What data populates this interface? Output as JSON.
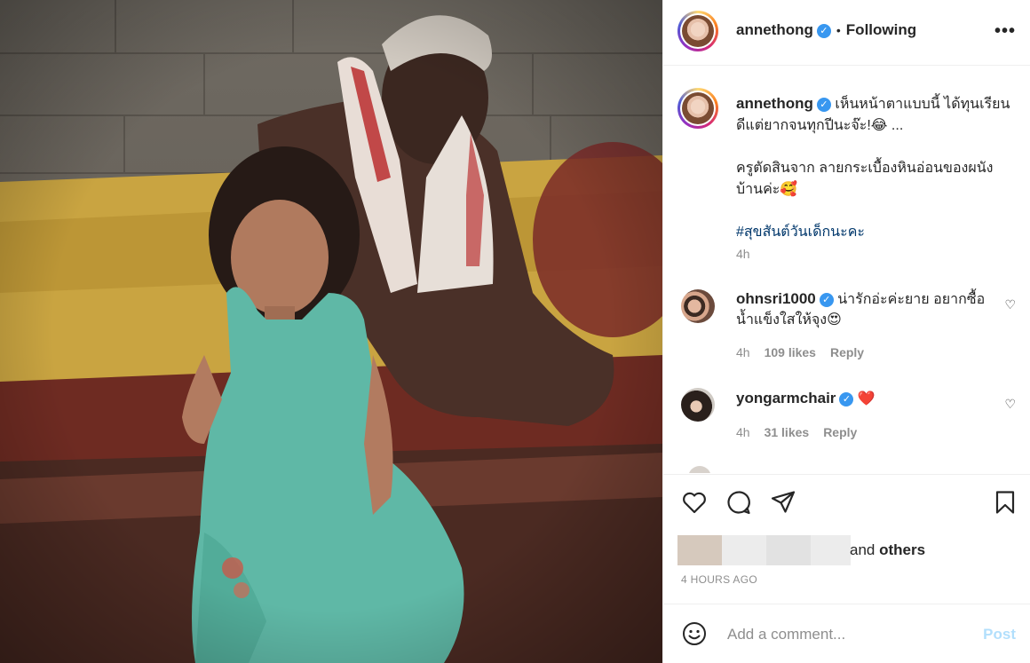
{
  "post": {
    "username": "annethong",
    "verified_icon": "verified-badge-icon",
    "dot": "•",
    "following_label": "Following",
    "more_label": "•••"
  },
  "caption": {
    "username": "annethong",
    "line1": "เห็นหน้าตาแบบนี้ ได้ทุนเรียน",
    "line2": "ดีแต่ยากจนทุกปีนะจ๊ะ!😂 ...",
    "line3": "ครูตัดสินจาก ลายกระเบื้องหินอ่อนของผนัง",
    "line4": "บ้านค่ะ🥰",
    "hashtag": "#สุขสันต์วันเด็กนะคะ",
    "time": "4h"
  },
  "comments": [
    {
      "username": "ohnsri1000",
      "text": "น่ารักอ่ะค่ะยาย อยากซื้อ",
      "text2": "น้ำแข็งใสให้จุง😍",
      "time": "4h",
      "likes": "109 likes",
      "reply": "Reply"
    },
    {
      "username": "yongarmchair",
      "text": "❤️",
      "time": "4h",
      "likes": "31 likes",
      "reply": "Reply"
    }
  ],
  "actions": {
    "icons": [
      "heart-icon",
      "comment-icon",
      "share-icon",
      "bookmark-icon"
    ],
    "and_text": "and",
    "others_text": "others",
    "timestamp": "4 HOURS AGO"
  },
  "add_comment": {
    "placeholder": "Add a comment...",
    "post_label": "Post"
  },
  "colors": {
    "accent": "#3897f0",
    "post_disabled": "#b2dffc",
    "hashtag": "#00376b",
    "secondary_text": "#8e8e8e"
  }
}
